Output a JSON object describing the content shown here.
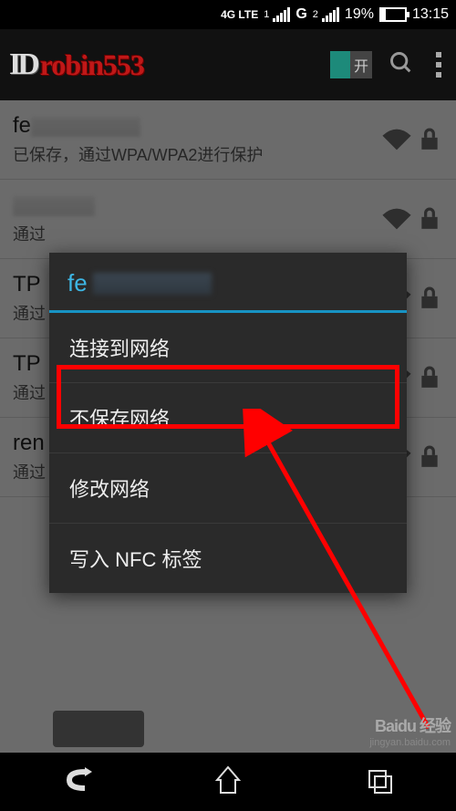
{
  "status": {
    "network_type": "4G LTE",
    "signal_1_label": "1",
    "carrier_g": "G",
    "signal_2_label": "2",
    "battery_percent": "19%",
    "time": "13:15"
  },
  "header": {
    "logo_prefix": "ID",
    "logo_name": "robin553",
    "toggle_label": "开"
  },
  "wifi_list": [
    {
      "ssid_prefix": "fe",
      "subtitle": "已保存，通过WPA/WPA2进行保护",
      "locked": true
    },
    {
      "ssid_prefix": "",
      "subtitle": "通过",
      "locked": true
    },
    {
      "ssid_prefix": "TP",
      "subtitle": "通过",
      "locked": true
    },
    {
      "ssid_prefix": "TP",
      "subtitle": "通过",
      "locked": true
    },
    {
      "ssid_prefix": "ren",
      "subtitle": "通过",
      "locked": true
    }
  ],
  "dialog": {
    "title_prefix": "fe",
    "items": [
      "连接到网络",
      "不保存网络",
      "修改网络",
      "写入 NFC 标签"
    ],
    "highlighted_index": 1
  },
  "watermark": {
    "brand": "Baidu 经验",
    "url": "jingyan.baidu.com"
  }
}
